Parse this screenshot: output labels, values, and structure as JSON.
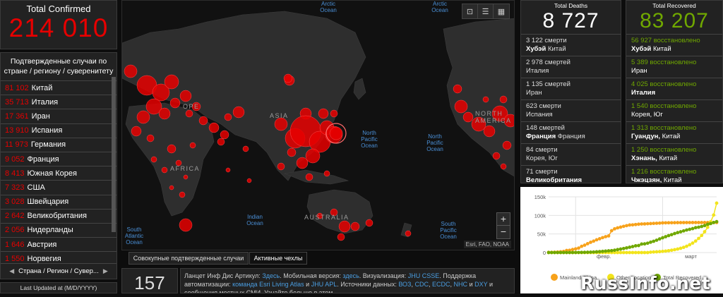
{
  "confirmed": {
    "label": "Total Confirmed",
    "value": "214 010"
  },
  "country_panel": {
    "header": "Подтвержденные случаи по стране / региону / суверенитету",
    "rows": [
      {
        "value": "81 102",
        "name": "Китай"
      },
      {
        "value": "35 713",
        "name": "Италия"
      },
      {
        "value": "17 361",
        "name": "Иран"
      },
      {
        "value": "13 910",
        "name": "Испания"
      },
      {
        "value": "11 973",
        "name": "Германия"
      },
      {
        "value": "9 052",
        "name": "Франция"
      },
      {
        "value": "8 413",
        "name": "Южная Корея"
      },
      {
        "value": "7 323",
        "name": "США"
      },
      {
        "value": "3 028",
        "name": "Швейцария"
      },
      {
        "value": "2 642",
        "name": "Великобритания"
      },
      {
        "value": "2 056",
        "name": "Нидерланды"
      },
      {
        "value": "1 646",
        "name": "Австрия"
      },
      {
        "value": "1 550",
        "name": "Норвегия"
      }
    ],
    "footer": "Страна / Регион / Сувер..."
  },
  "updated": {
    "label": "Last Updated at (M/D/YYYY)"
  },
  "map": {
    "oceans": {
      "arctic": "Arctic Ocean",
      "arctic2": "Arctic Ocean",
      "north_pacific_1": "North Pacific Ocean",
      "north_pacific_2": "North Pacific Ocean",
      "south_pacific": "South Pacific Ocean",
      "indian": "Indian Ocean",
      "south_atlantic": "South Atlantic Ocean"
    },
    "continents": {
      "africa": "AFRICA",
      "australia": "AUSTRALIA",
      "asia": "ASIA",
      "europe": "OPE",
      "north_america": "NORTH AMERICA"
    },
    "zoom_in": "+",
    "zoom_out": "−",
    "attribution": "Esri, FAO, NOAA"
  },
  "tabs": {
    "cumulative": "Совокупные подтвержденные случаи",
    "active": "Активные чехлы"
  },
  "count": {
    "value": "157"
  },
  "info": {
    "p1": "Ланцет Инф Дис Артикул:",
    "l1": "Здесь",
    "p2": ". Мобильная версия:",
    "l2": "здесь",
    "p3": ". Визуализация:",
    "l3": "JHU CSSE",
    "p4": ". Поддержка автоматизации:",
    "l4": "команда Esri Living Atlas",
    "p5": "и",
    "l5": "JHU APL",
    "p6": ". Источники данных:",
    "l6": "ВОЗ",
    "l7": "CDC",
    "l8": "ECDC",
    "l9": "NHC",
    "l10": "DXY",
    "p7": "и сообщения местных СМИ. Узнайте больше в этом"
  },
  "deaths": {
    "label": "Total Deaths",
    "value": "8 727",
    "rows": [
      {
        "num": "3 122",
        "unit": "смерти",
        "place_b": "Хубэй",
        "place": "Китай"
      },
      {
        "num": "2 978",
        "unit": "смертей",
        "place_b": "",
        "place": "Италия"
      },
      {
        "num": "1 135",
        "unit": "смертей",
        "place_b": "",
        "place": "Иран"
      },
      {
        "num": "623",
        "unit": "смерти",
        "place_b": "",
        "place": "Испания"
      },
      {
        "num": "148",
        "unit": "смертей",
        "place_b": "Франция",
        "place": "Франция"
      },
      {
        "num": "84",
        "unit": "смерти",
        "place_b": "",
        "place": "Корея, Юг"
      },
      {
        "num": "71",
        "unit": "смерти",
        "place_b": "Великобритания",
        "place": "Великобритания"
      }
    ]
  },
  "recovered": {
    "label": "Total Recovered",
    "value": "83 207",
    "rows": [
      {
        "num": "56 927",
        "unit": "восстановлено",
        "place_b": "Хубэй",
        "place": "Китай"
      },
      {
        "num": "5 389",
        "unit": "восстановлено",
        "place_b": "",
        "place": "Иран"
      },
      {
        "num": "4 025",
        "unit": "восстановлено",
        "place_b": "Италия",
        "place": ""
      },
      {
        "num": "1 540",
        "unit": "восстановлено",
        "place_b": "",
        "place": "Корея, Юг"
      },
      {
        "num": "1 313",
        "unit": "восстановлено",
        "place_b": "Гуандун,",
        "place": "Китай"
      },
      {
        "num": "1 250",
        "unit": "восстановлено",
        "place_b": "Хэнань,",
        "place": "Китай"
      },
      {
        "num": "1 216",
        "unit": "восстановлено",
        "place_b": "Чжэцзян,",
        "place": "Китай"
      }
    ]
  },
  "chart_data": {
    "type": "line",
    "title": "",
    "xlabel": "",
    "ylabel": "",
    "x_ticks": [
      "февр.",
      "март"
    ],
    "y_ticks": [
      "0",
      "50k",
      "100k",
      "150k"
    ],
    "ylim": [
      0,
      150000
    ],
    "x": [
      0,
      1,
      2,
      3,
      4,
      5,
      6,
      7,
      8,
      9,
      10,
      11,
      12,
      13,
      14,
      15,
      16,
      17,
      18,
      19,
      20,
      21,
      22,
      23,
      24,
      25,
      26,
      27,
      28,
      29,
      30,
      31,
      32,
      33,
      34,
      35,
      36,
      37,
      38,
      39,
      40,
      41,
      42,
      43,
      44,
      45,
      46,
      47,
      48,
      49,
      50,
      51,
      52,
      53,
      54,
      55,
      56
    ],
    "series": [
      {
        "name": "Mainland China",
        "color": "#f7a21b",
        "values": [
          555,
          653,
          941,
          1438,
          2118,
          2927,
          5578,
          6165,
          8235,
          9925,
          12038,
          16787,
          19881,
          23892,
          27636,
          30818,
          34392,
          37121,
          40151,
          42763,
          44803,
          58761,
          63851,
          66492,
          68500,
          70548,
          72436,
          74185,
          74576,
          75465,
          76288,
          76936,
          77150,
          77658,
          78064,
          78497,
          78824,
          79251,
          79826,
          80026,
          80151,
          80270,
          80409,
          80552,
          80651,
          80695,
          80735,
          80754,
          80778,
          80793,
          80813,
          80824,
          80844,
          80860,
          80881,
          80894,
          80928
        ]
      },
      {
        "name": "Other Locations",
        "color": "#f2e41c",
        "values": [
          0,
          0,
          0,
          0,
          0,
          0,
          0,
          0,
          0,
          0,
          0,
          0,
          0,
          0,
          0,
          0,
          0,
          0,
          0,
          0,
          0,
          0,
          0,
          0,
          0,
          0,
          0,
          0,
          0,
          0,
          0,
          0,
          0,
          0,
          1000,
          1500,
          2000,
          2500,
          3200,
          4000,
          5000,
          6300,
          7800,
          9500,
          11500,
          14000,
          17000,
          21000,
          25500,
          31000,
          38000,
          46000,
          56000,
          68000,
          83000,
          101000,
          133000
        ]
      },
      {
        "name": "Total Recovered",
        "color": "#70a800",
        "values": [
          28,
          30,
          36,
          39,
          52,
          61,
          107,
          126,
          143,
          222,
          284,
          472,
          623,
          852,
          1124,
          1487,
          2011,
          2616,
          3244,
          3946,
          4683,
          5150,
          6295,
          8058,
          9395,
          10865,
          12583,
          14352,
          16121,
          18177,
          18890,
          22886,
          23394,
          25227,
          27905,
          30384,
          33277,
          36711,
          39782,
          42716,
          45602,
          48228,
          51170,
          53796,
          55865,
          58359,
          60695,
          62512,
          64404,
          67003,
          68324,
          70251,
          72624,
          76034,
          78088,
          80840,
          83207
        ]
      }
    ]
  },
  "watermark": {
    "text": "RussInfo.net"
  }
}
